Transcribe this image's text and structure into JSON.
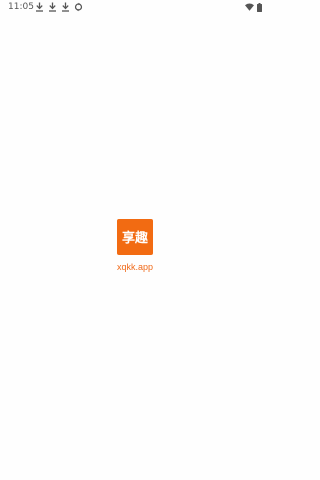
{
  "status_bar": {
    "time": "11:05",
    "left_icons": [
      "download-icon",
      "download-icon",
      "download-icon",
      "sync-icon"
    ],
    "right_icons": [
      "wifi-icon",
      "battery-icon"
    ]
  },
  "splash": {
    "logo_text": "享趣",
    "url": "xqkk.app",
    "brand_color": "#f26b12"
  },
  "colors": {
    "background": "#fefefe",
    "status_icons": "#555555",
    "url_text": "#f06a1a"
  }
}
